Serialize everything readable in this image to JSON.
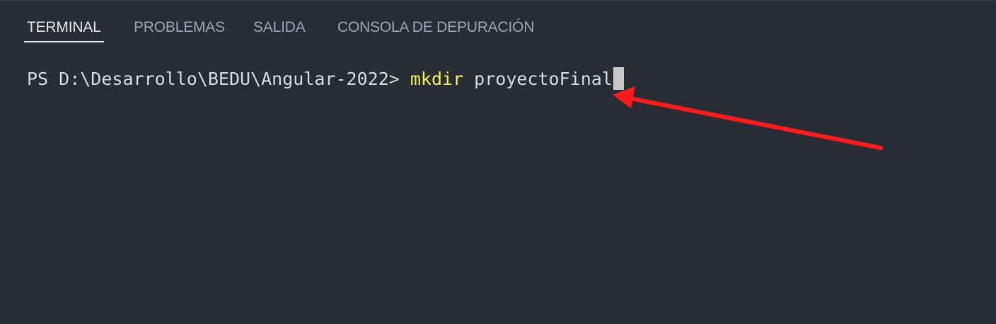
{
  "tabs": [
    {
      "label": "TERMINAL",
      "active": true
    },
    {
      "label": "PROBLEMAS",
      "active": false
    },
    {
      "label": "SALIDA",
      "active": false
    },
    {
      "label": "CONSOLA DE DEPURACIÓN",
      "active": false
    }
  ],
  "terminal": {
    "prompt": "PS D:\\Desarrollo\\BEDU\\Angular-2022> ",
    "command": "mkdir",
    "argument": " proyectoFinal"
  },
  "colors": {
    "background": "#282c34",
    "text": "#d7dae0",
    "command": "#f2f24a",
    "arrow": "#ff1a1a"
  },
  "icons": {
    "annotation": "red-arrow-icon"
  }
}
